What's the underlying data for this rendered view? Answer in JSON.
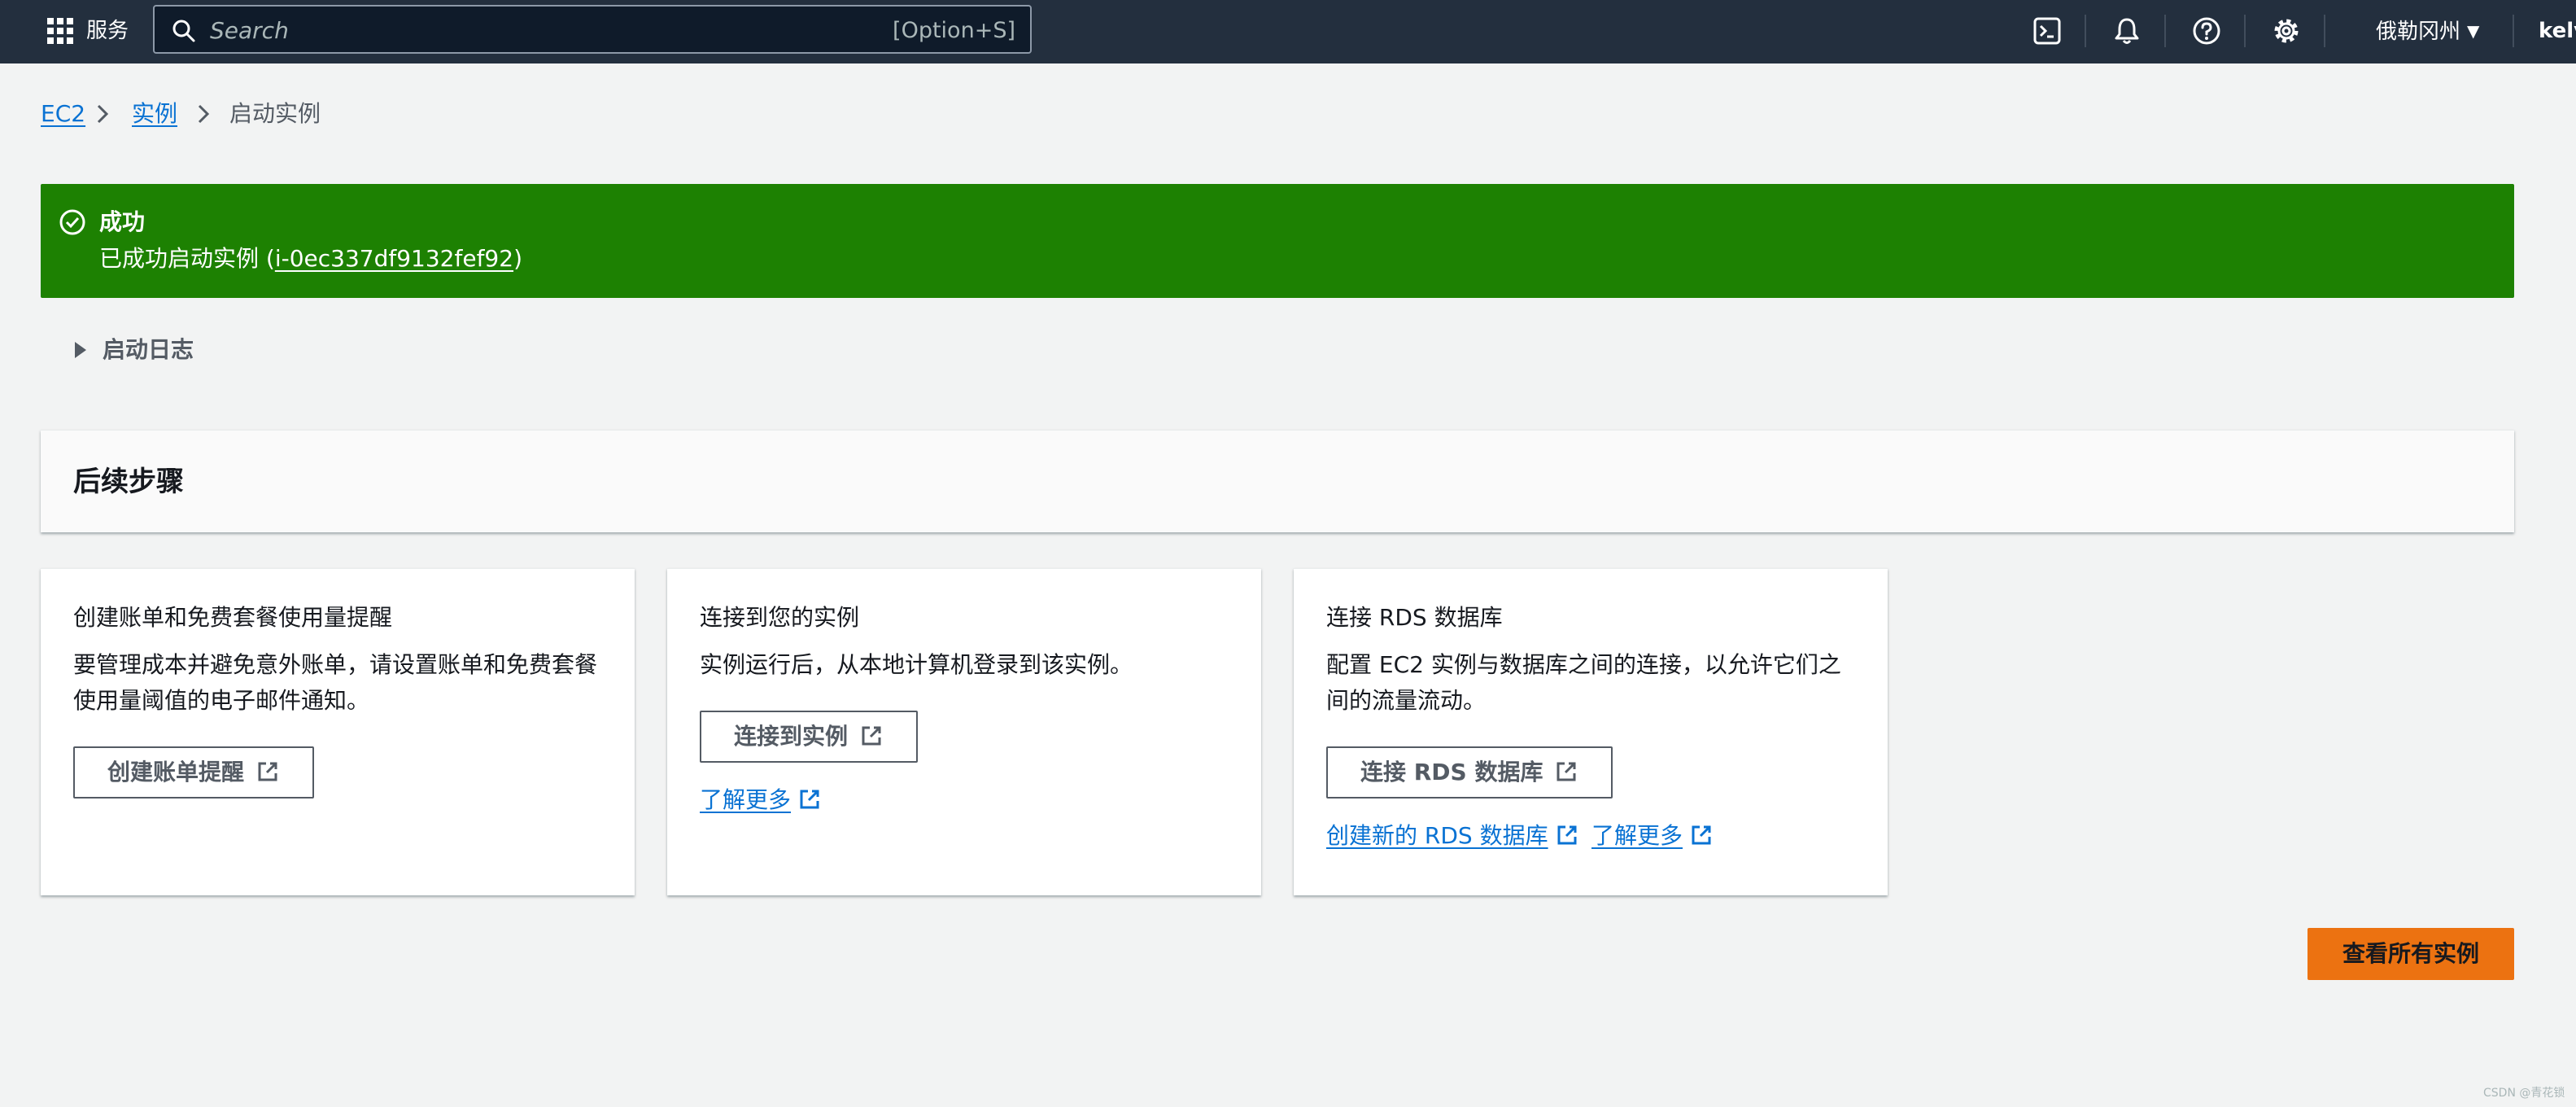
{
  "topnav": {
    "services_label": "服务",
    "search_placeholder": "Search",
    "search_shortcut": "[Option+S]",
    "region": "俄勒冈州",
    "user": "kelvi",
    "icons": [
      "cloudshell-icon",
      "notifications-bell-icon",
      "help-icon",
      "settings-gear-icon"
    ]
  },
  "breadcrumb": {
    "items": [
      "EC2",
      "实例"
    ],
    "current": "启动实例"
  },
  "flash": {
    "type": "success",
    "title": "成功",
    "message_prefix": "已成功启动实例 (",
    "instance_id": "i-0ec337df9132fef92",
    "message_suffix": ")"
  },
  "launch_log": {
    "label": "启动日志"
  },
  "next_steps": {
    "title": "后续步骤",
    "cards": [
      {
        "title": "创建账单和免费套餐使用量提醒",
        "description": "要管理成本并避免意外账单，请设置账单和免费套餐使用量阈值的电子邮件通知。",
        "button": "创建账单提醒"
      },
      {
        "title": "连接到您的实例",
        "description": "实例运行后，从本地计算机登录到该实例。",
        "button": "连接到实例",
        "link": "了解更多"
      },
      {
        "title": "连接 RDS 数据库",
        "description": "配置 EC2 实例与数据库之间的连接，以允许它们之间的流量流动。",
        "button": "连接 RDS 数据库",
        "links": [
          "创建新的 RDS 数据库",
          "了解更多"
        ]
      }
    ]
  },
  "primary_action": "查看所有实例",
  "watermark": "CSDN @青花锁",
  "colors": {
    "nav_bg": "#232f3e",
    "success": "#1d8102",
    "link": "#0972d3",
    "primary": "#ec7211",
    "page_bg": "#f2f3f3"
  }
}
